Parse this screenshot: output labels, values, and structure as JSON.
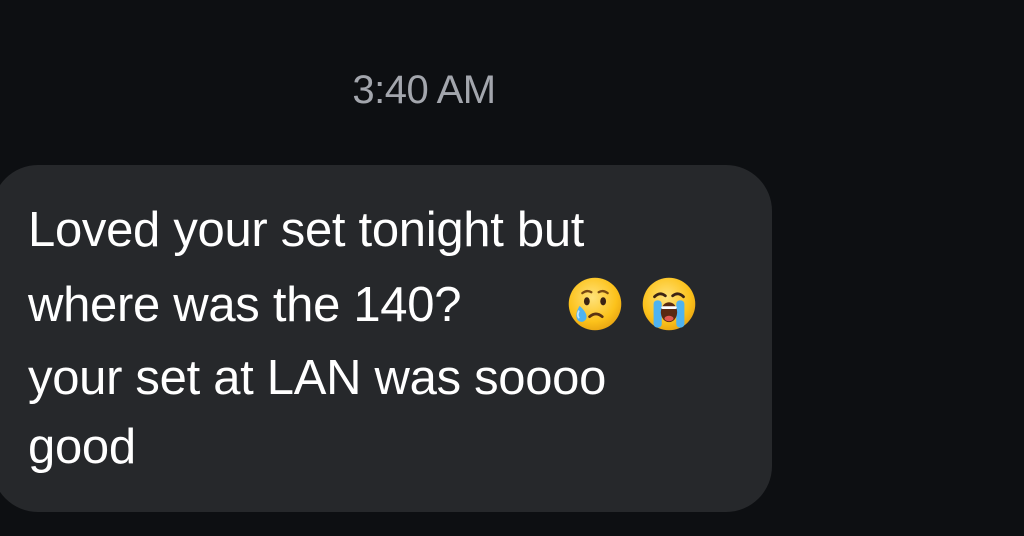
{
  "conversation": {
    "timestamp": "3:40 AM",
    "message": {
      "lines": [
        "Loved your set tonight but",
        "where was the 140?",
        "your set at LAN was soooo",
        "good"
      ],
      "emojis": [
        "face-holding-back-tears-icon",
        "loudly-crying-face-icon"
      ],
      "bubble_color": "#26282b",
      "text_color": "#ffffff"
    }
  },
  "colors": {
    "background": "#0d0f12",
    "timestamp": "#a3a6ad"
  }
}
